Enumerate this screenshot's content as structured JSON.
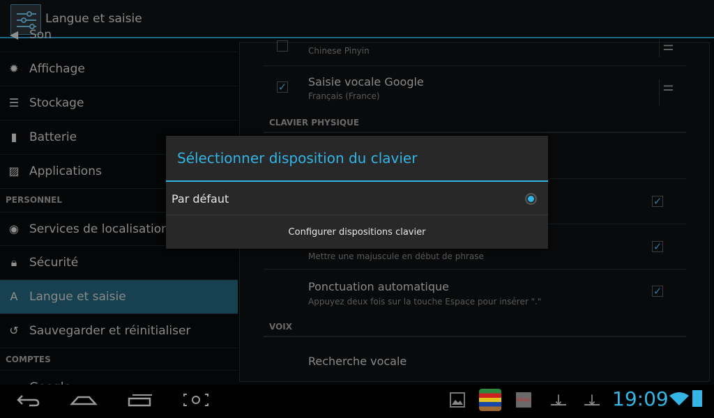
{
  "app": {
    "title": "Langue et saisie",
    "icon": "settings-sliders-icon"
  },
  "sidebar": {
    "items": [
      {
        "label": "Son",
        "icon": "volume-icon"
      },
      {
        "label": "Affichage",
        "icon": "brightness-icon"
      },
      {
        "label": "Stockage",
        "icon": "storage-icon"
      },
      {
        "label": "Batterie",
        "icon": "battery-icon"
      },
      {
        "label": "Applications",
        "icon": "apps-icon"
      },
      {
        "label": "Services de localisation",
        "icon": "location-icon"
      },
      {
        "label": "Sécurité",
        "icon": "lock-icon"
      },
      {
        "label": "Langue et saisie",
        "icon": "language-icon",
        "selected": true
      },
      {
        "label": "Sauvegarder et réinitialiser",
        "icon": "backup-icon"
      },
      {
        "label": "Google",
        "icon": "google-icon"
      }
    ],
    "headers": [
      "PERSONNEL",
      "COMPTES"
    ]
  },
  "content": {
    "pinyin_sub": "Chinese Pinyin",
    "voice_title": "Saisie vocale Google",
    "voice_sub": "Français (France)",
    "section_physical": "CLAVIER PHYSIQUE",
    "caps_sub": "Mettre une majuscule en début de phrase",
    "punct_title": "Ponctuation automatique",
    "punct_sub": "Appuyez deux fois sur la touche Espace pour insérer \".\"",
    "section_voice": "VOIX",
    "voice_search": "Recherche vocale"
  },
  "dialog": {
    "title": "Sélectionner disposition du clavier",
    "option": "Par défaut",
    "option_selected": true,
    "button": "Configurer dispositions clavier"
  },
  "status": {
    "time": "19:09",
    "accent": "#33b5e5"
  }
}
